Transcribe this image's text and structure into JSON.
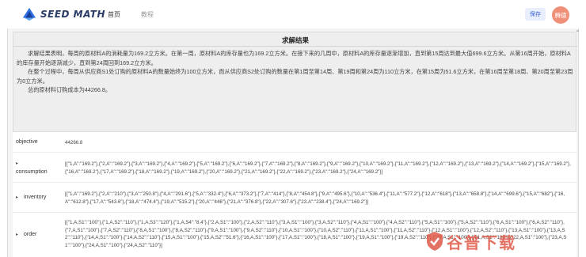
{
  "header": {
    "logo_text": "SEED MATH",
    "nav": [
      "首页",
      "教程"
    ],
    "save_label": "保存",
    "avatar_label": "腾德"
  },
  "result_panel": {
    "title": "求解结果",
    "paragraphs": [
      "求解结果表明，每周的原材料A的消耗量为169.2立方米。在第一周，原材料A的库存量也为169.2立方米。在接下来的几周中，原材料A的库存量逐渐增加，直到第15周达到最大值699.6立方米。从第16周开始，原材料A的库存量开始逐渐减少，直到第24周回到169.2立方米。",
      "在整个过程中，每周从供应商S1处订购的原材料A的数量始终为100立方米，而从供应商S2处订购的数量在第1周至第14周、第19周和第24周为110立方米，在第15周为51.6立方米，在第16周至第18周、第20周至第23周为0立方米。",
      "总的原材料订购成本为44266.8。"
    ]
  },
  "results": {
    "objective": {
      "label": "objective",
      "value": "44266.8"
    },
    "consumption": {
      "label": "consumption",
      "value": "[{\"1,A\":\"169.2\"},{\"2,A\":\"169.2\"},{\"3,A\":\"169.2\"},{\"4,A\":\"169.2\"},{\"5,A\":\"169.2\"},{\"6,A\":\"169.2\"},{\"7,A\":\"169.2\"},{\"8,A\":\"169.2\"},{\"9,A\":\"169.2\"},{\"10,A\":\"169.2\"},{\"11,A\":\"169.2\"},{\"12,A\":\"169.2\"},{\"13,A\":\"169.2\"},{\"14,A\":\"169.2\"},{\"15,A\":\"169.2\"},{\"16,A\":\"169.2\"},{\"17,A\":\"169.2\"},{\"18,A\":\"169.2\"},{\"19,A\":\"169.2\"},{\"20,A\":\"169.2\"},{\"21,A\":\"169.2\"},{\"22,A\":\"169.2\"},{\"23,A\":\"169.2\"},{\"24,A\":\"169.2\"}]"
    },
    "inventory": {
      "label": "inventory",
      "value": "[{\"1,A\":\"169.2\"},{\"2,A\":\"210\"},{\"3,A\":\"250.8\"},{\"4,A\":\"291.6\"},{\"5,A\":\"332.4\"},{\"6,A\":\"373.2\"},{\"7,A\":\"414\"},{\"8,A\":\"454.8\"},{\"9,A\":\"495.6\"},{\"10,A\":\"536.4\"},{\"11,A\":\"577.2\"},{\"12,A\":\"618\"},{\"13,A\":\"658.8\"},{\"14,A\":\"699.6\"},{\"15,A\":\"682\"},{\"16,A\":\"612.8\"},{\"17,A\":\"543.6\"},{\"18,A\":\"474.4\"},{\"19,A\":\"515.2\"},{\"20,A\":\"446\"},{\"21,A\":\"376.8\"},{\"22,A\":\"307.6\"},{\"23,A\":\"238.4\"},{\"24,A\":\"169.2\"}]"
    },
    "order": {
      "label": "order",
      "value": "[{\"1,A,S1\":\"100\"},{\"1,A,S2\":\"110\"},{\"1,A,S3\":\"120\"},{\"1,A,S4\":\"8.4\"},{\"2,A,S1\":\"100\"},{\"2,A,S2\":\"110\"},{\"3,A,S1\":\"100\"},{\"3,A,S2\":\"110\"},{\"4,A,S1\":\"100\"},{\"4,A,S2\":\"110\"},{\"5,A,S1\":\"100\"},{\"5,A,S2\":\"110\"},{\"6,A,S1\":\"100\"},{\"6,A,S2\":\"110\"},{\"7,A,S1\":\"100\"},{\"7,A,S2\":\"110\"},{\"8,A,S1\":\"100\"},{\"8,A,S2\":\"110\"},{\"9,A,S1\":\"100\"},{\"9,A,S2\":\"110\"},{\"10,A,S1\":\"100\"},{\"10,A,S2\":\"110\"},{\"11,A,S1\":\"100\"},{\"11,A,S2\":\"110\"},{\"12,A,S1\":\"100\"},{\"12,A,S2\":\"110\"},{\"13,A,S1\":\"100\"},{\"13,A,S2\":\"110\"},{\"14,A,S1\":\"100\"},{\"14,A,S2\":\"110\"},{\"15,A,S1\":\"100\"},{\"15,A,S2\":\"51.6\"},{\"16,A,S1\":\"100\"},{\"17,A,S1\":\"100\"},{\"18,A,S1\":\"100\"},{\"19,A,S1\":\"100\"},{\"19,A,S2\":\"110\"},{\"20,A,S1\":\"100\"},{\"21,A,S1\":\"100\"},{\"22,A,S1\":\"100\"},{\"23,A,S1\":\"100\"},{\"24,A,S1\":\"100\"},{\"24,A,S2\":\"110\"}]"
    }
  },
  "watermark": {
    "text": "谷普下载"
  }
}
